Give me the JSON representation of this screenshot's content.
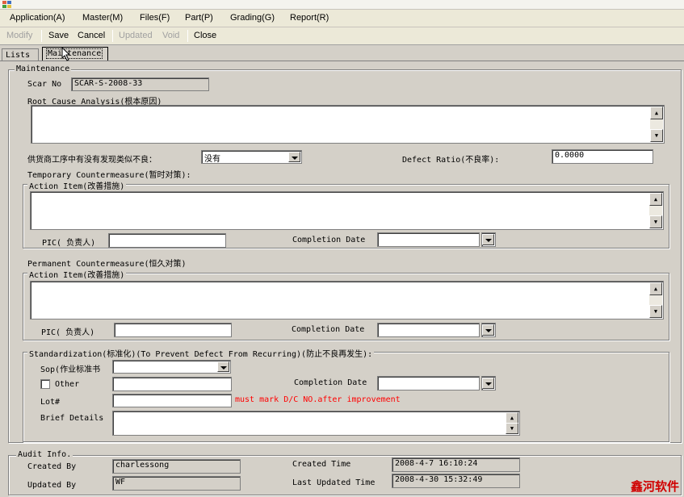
{
  "menu": [
    "Application(A)",
    "Master(M)",
    "Files(F)",
    "Part(P)",
    "Grading(G)",
    "Report(R)"
  ],
  "toolbar": {
    "modify": "Modify",
    "save": "Save",
    "cancel": "Cancel",
    "updated": "Updated",
    "void": "Void",
    "close": "Close"
  },
  "tabs": {
    "lists": "Lists",
    "maintenance": "Maintenance"
  },
  "maintenance": {
    "legend": "Maintenance",
    "scar_label": "Scar No",
    "scar_value": "SCAR-S-2008-33",
    "root_cause_label": "Root Cause Analysis(根本原因)",
    "supplier_question": "供货商工序中有没有发现类似不良：",
    "supplier_answer": "没有",
    "defect_ratio_label": "Defect Ratio(不良率):",
    "defect_ratio_value": "0.0000",
    "temporary_label": "Temporary Countermeasure(暂时对策):",
    "permanent_label": "Permanent Countermeasure(恒久对策)",
    "action_item_label": "Action Item(改善措施)",
    "pic_label": "PIC( 负责人)",
    "completion_label": "Completion Date",
    "standardization_label": "Standardization(标准化)(To Prevent Defect From Recurring)(防止不良再发生):",
    "sop_label": "Sop(作业标准书",
    "other_label": "Other",
    "lot_label": "Lot#",
    "lot_note": "must  mark D/C NO.after improvement",
    "brief_label": "Brief Details"
  },
  "audit": {
    "legend": "Audit Info.",
    "created_by_label": "Created By",
    "created_by_value": "charlessong",
    "updated_by_label": "Updated By",
    "updated_by_value": "WF",
    "created_time_label": "Created Time",
    "created_time_value": "2008-4-7 16:10:24",
    "last_updated_label": "Last Updated Time",
    "last_updated_value": "2008-4-30 15:32:49"
  },
  "watermark": "鑫河软件"
}
